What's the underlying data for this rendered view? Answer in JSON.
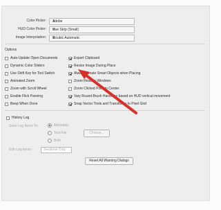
{
  "general": {
    "color_picker_label": "Color Picker:",
    "color_picker_value": "Adobe",
    "hud_picker_label": "HUD Color Picker:",
    "hud_picker_value": "Hue Strip (Small)",
    "interp_label": "Image Interpolation:",
    "interp_value": "Bicubic Automatic"
  },
  "options": {
    "title": "Options",
    "left": [
      {
        "label": "Auto-Update Open Documents",
        "checked": false
      },
      {
        "label": "Dynamic Color Sliders",
        "checked": false
      },
      {
        "label": "Use Shift Key for Tool Switch",
        "checked": false
      },
      {
        "label": "Animated Zoom",
        "checked": false
      },
      {
        "label": "Zoom with Scroll Wheel",
        "checked": false
      },
      {
        "label": "Enable Flick Panning",
        "checked": false
      },
      {
        "label": "Beep When Done",
        "checked": false
      }
    ],
    "right": [
      {
        "label": "Export Clipboard",
        "checked": true
      },
      {
        "label": "Resize Image During Place",
        "checked": true
      },
      {
        "label": "Always Create Smart Objects when Placing",
        "checked": true
      },
      {
        "label": "Zoom Resizes Windows",
        "checked": false
      },
      {
        "label": "Zoom Clicked Point to Center",
        "checked": false
      },
      {
        "label": "Vary Round Brush Hardness based on HUD vertical movement",
        "checked": true
      },
      {
        "label": "Snap Vector Tools and Transforms to Pixel Grid",
        "checked": true
      }
    ]
  },
  "history": {
    "title": "History Log",
    "save_items_label": "Save Log Items To:",
    "radios": [
      {
        "label": "Metadata",
        "selected": true
      },
      {
        "label": "Text File",
        "selected": false
      },
      {
        "label": "Both",
        "selected": false
      }
    ],
    "choose_label": "Choose...",
    "edit_log_label": "Edit Log Items:",
    "edit_log_value": "Sessions Only"
  },
  "reset_label": "Reset All Warning Dialogs",
  "icons": {
    "dropdown": "chevron-down-icon",
    "annotation": "red-arrow-annotation"
  },
  "colors": {
    "arrow": "#d6302b"
  }
}
